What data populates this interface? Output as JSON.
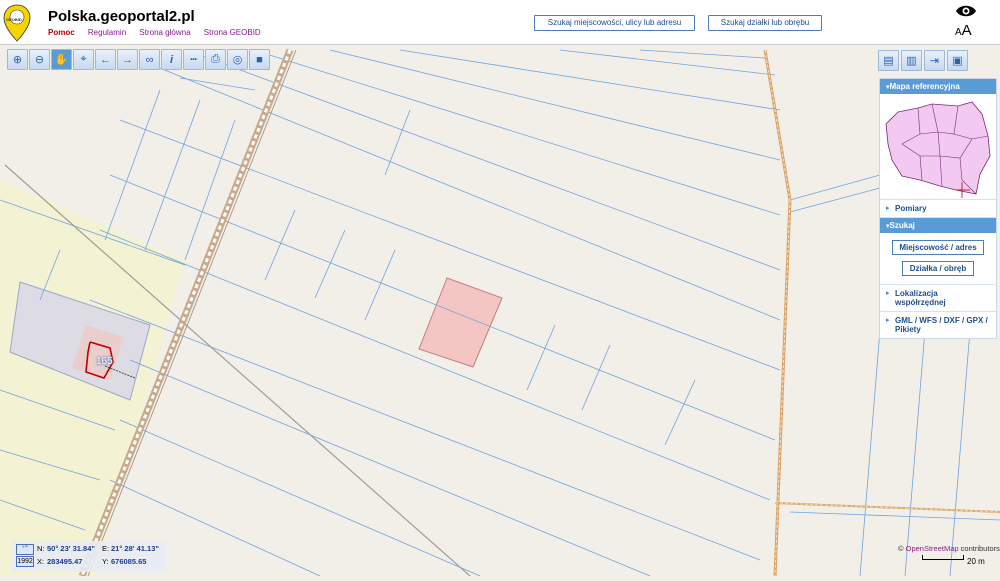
{
  "header": {
    "title": "Polska.geoportal2.pl",
    "logo_text": "GEOBID",
    "nav": [
      "Pomoc",
      "Regulamin",
      "Strona główna",
      "Strona GEOBID"
    ],
    "search_place_button": "Szukaj miejscowości, ulicy lub adresu",
    "search_parcel_button": "Szukaj działki lub obrębu",
    "font_size_label": "A"
  },
  "toolbar": {
    "icons": [
      "zoom-in-icon",
      "zoom-out-icon",
      "pan-hand-icon",
      "zoom-box-icon",
      "back-arrow-icon",
      "forward-arrow-icon",
      "link-icon",
      "info-icon",
      "measure-ruler-icon",
      "print-icon",
      "globe-icon",
      "video-icon"
    ]
  },
  "panel": {
    "reference_map": "Mapa referencyjna",
    "measurements": "Pomiary",
    "search": "Szukaj",
    "place_button": "Miejscowość / adres",
    "parcel_button": "Działka / obręb",
    "coordinate_location": "Lokalizacja współrzędnej",
    "formats": "GML / WFS / DXF / GPX / Pikiety"
  },
  "map": {
    "parcel_label": "165",
    "highlight_color": "#f4c6c3",
    "parcel_line_color": "#4a90e2",
    "building_color": "#c00000"
  },
  "coords": {
    "n_label": "N:",
    "n_value": "50° 23' 31.84\"",
    "e_label": "E:",
    "e_value": "21° 28' 41.13\"",
    "system": "1992",
    "x_label": "X:",
    "x_value": "283495.47",
    "y_label": "Y:",
    "y_value": "676085.65"
  },
  "attribution": {
    "prefix": "©",
    "link": "OpenStreetMap",
    "suffix": "contributors"
  },
  "scale": "20 m"
}
